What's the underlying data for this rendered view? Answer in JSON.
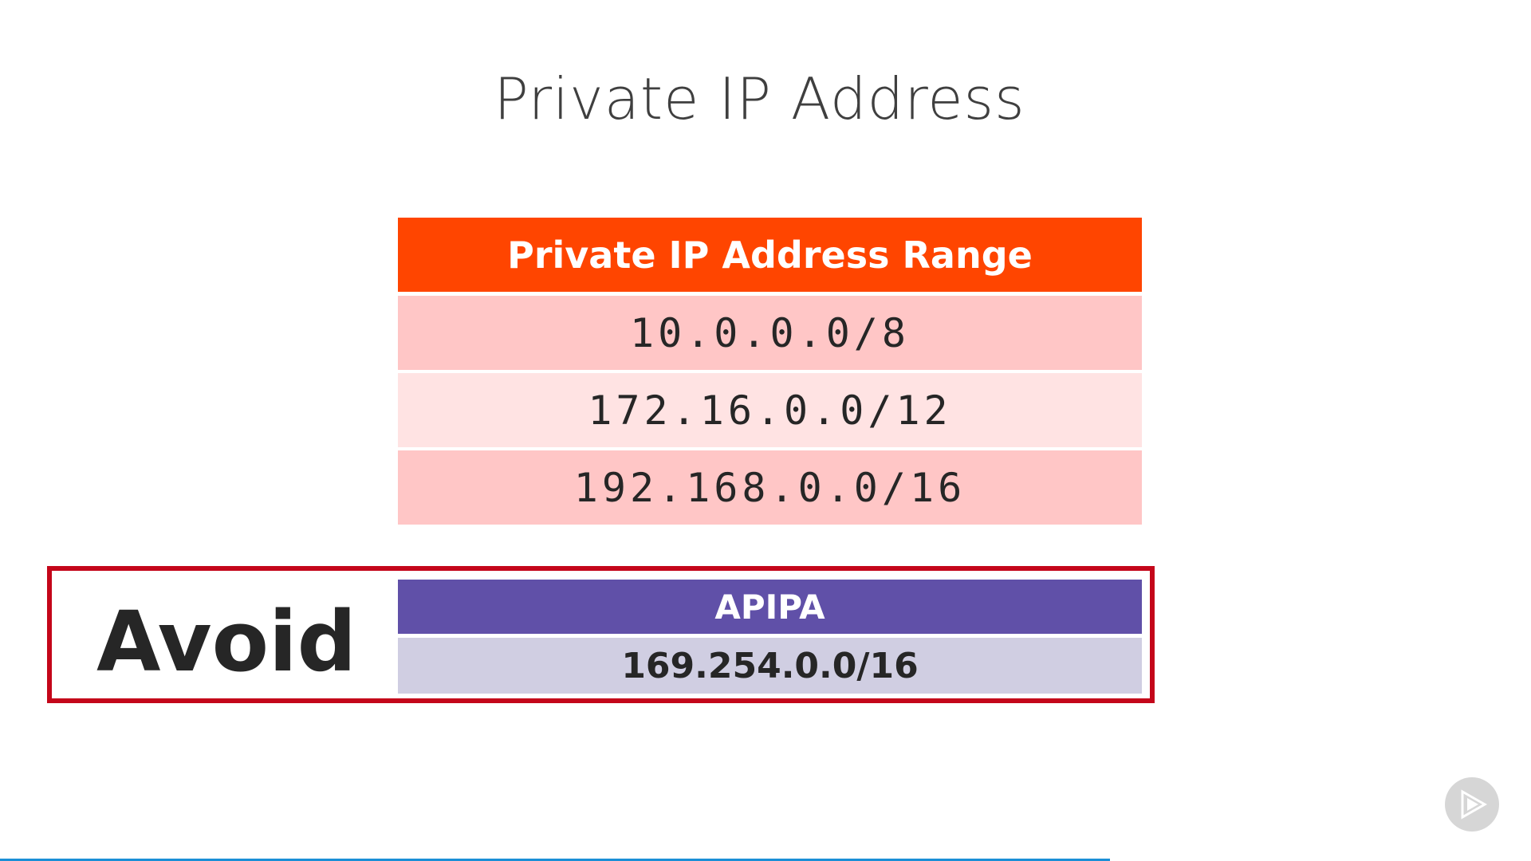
{
  "slide": {
    "title": "Private IP Address"
  },
  "range_table": {
    "header": "Private IP Address Range",
    "rows": [
      "10.0.0.0/8",
      "172.16.0.0/12",
      "192.168.0.0/16"
    ]
  },
  "avoid": {
    "label": "Avoid",
    "table": {
      "header": "APIPA",
      "value": "169.254.0.0/16"
    }
  },
  "player": {
    "badge_icon": "play-logo-icon",
    "progress_fraction": 0.725
  },
  "colors": {
    "range_header": "#ff4500",
    "range_row_dark": "#ffc6c6",
    "range_row_light": "#ffe3e3",
    "avoid_border": "#c4061a",
    "apipa_header": "#6050a8",
    "apipa_row": "#d0cee2",
    "progress": "#1a8fd6"
  }
}
